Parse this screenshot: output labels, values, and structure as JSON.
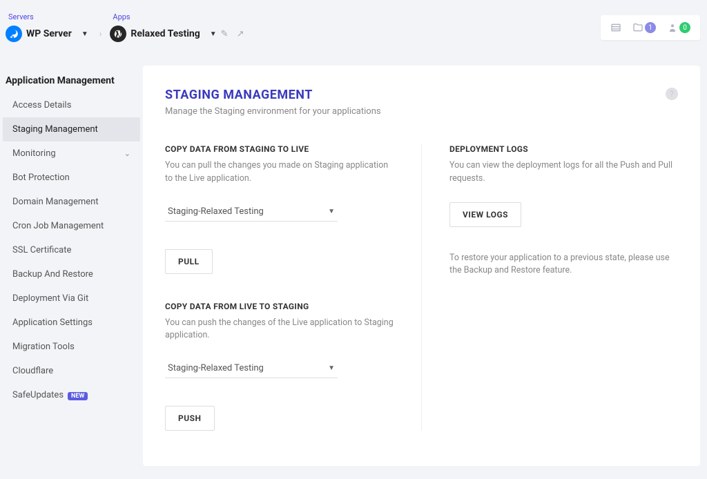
{
  "breadcrumb": {
    "servers_label": "Servers",
    "server_name": "WP Server",
    "apps_label": "Apps",
    "app_name": "Relaxed Testing"
  },
  "toolbar": {
    "folder_badge": "1",
    "user_badge": "0"
  },
  "sidebar": {
    "heading": "Application Management",
    "items": [
      {
        "label": "Access Details"
      },
      {
        "label": "Staging Management",
        "active": true
      },
      {
        "label": "Monitoring",
        "expandable": true
      },
      {
        "label": "Bot Protection"
      },
      {
        "label": "Domain Management"
      },
      {
        "label": "Cron Job Management"
      },
      {
        "label": "SSL Certificate"
      },
      {
        "label": "Backup And Restore"
      },
      {
        "label": "Deployment Via Git"
      },
      {
        "label": "Application Settings"
      },
      {
        "label": "Migration Tools"
      },
      {
        "label": "Cloudflare"
      },
      {
        "label": "SafeUpdates",
        "badge": "NEW"
      }
    ]
  },
  "page": {
    "title": "STAGING MANAGEMENT",
    "subtitle": "Manage the Staging environment for your applications"
  },
  "copy_to_live": {
    "title": "COPY DATA FROM STAGING TO LIVE",
    "desc": "You can pull the changes you made on Staging application to the Live application.",
    "select_value": "Staging-Relaxed Testing",
    "button": "PULL"
  },
  "copy_to_staging": {
    "title": "COPY DATA FROM LIVE TO STAGING",
    "desc": "You can push the changes of the Live application to Staging application.",
    "select_value": "Staging-Relaxed Testing",
    "button": "PUSH"
  },
  "logs": {
    "title": "DEPLOYMENT LOGS",
    "desc": "You can view the deployment logs for all the Push and Pull requests.",
    "button": "VIEW LOGS",
    "restore_note": "To restore your application to a previous state, please use the Backup and Restore feature."
  }
}
